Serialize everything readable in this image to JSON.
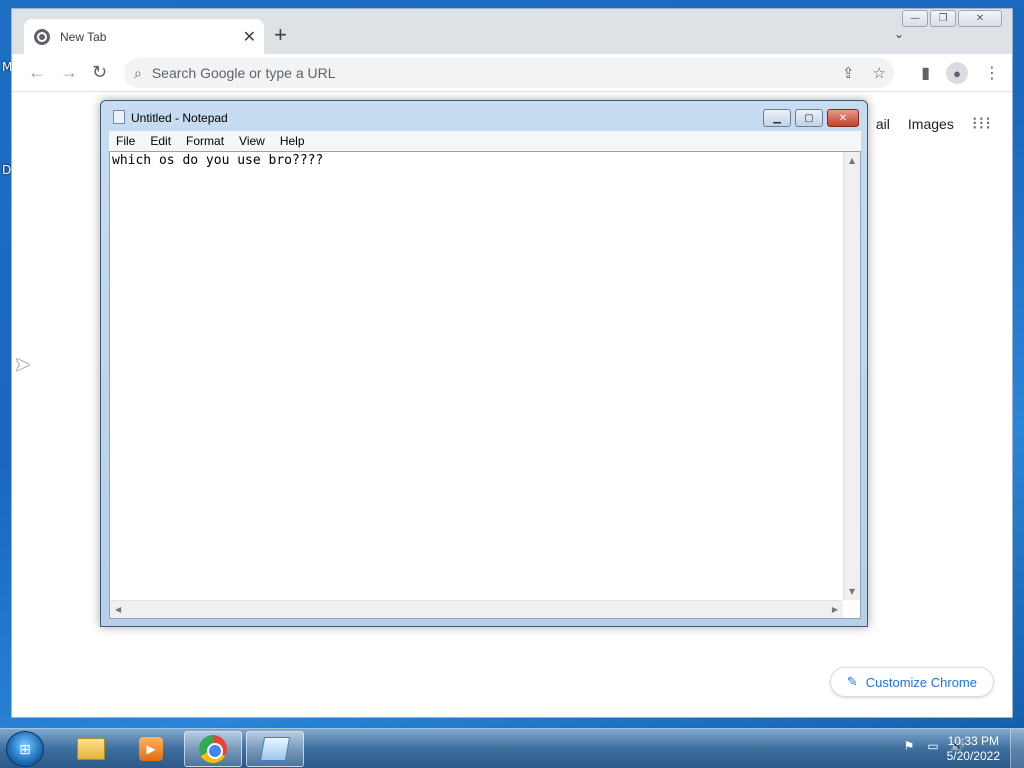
{
  "desktop": {
    "edge_labels": [
      "M",
      "D"
    ]
  },
  "chrome": {
    "tab": {
      "title": "New Tab",
      "close_icon": "✕"
    },
    "new_tab_icon": "+",
    "tab_search_icon": "⌄",
    "window_controls": {
      "minimize": "—",
      "maximize": "❐",
      "close": "✕"
    },
    "toolbar": {
      "back_icon": "←",
      "forward_icon": "→",
      "reload_icon": "↻",
      "omnibox_placeholder": "Search Google or type a URL",
      "search_icon": "🔍",
      "share_icon": "⇪",
      "star_icon": "☆",
      "sidepanel_icon": "▮",
      "profile_icon": "👤",
      "menu_icon": "⋮"
    },
    "ntp": {
      "gmail_label": "ail",
      "images_label": "Images",
      "apps_icon": "⋮⋮⋮",
      "customize_label": "Customize Chrome",
      "customize_icon": "✎"
    }
  },
  "notepad": {
    "title": "Untitled - Notepad",
    "controls": {
      "minimize": "▁",
      "maximize": "▢",
      "close": "✕"
    },
    "menu": [
      "File",
      "Edit",
      "Format",
      "View",
      "Help"
    ],
    "content": "which os do you use bro????"
  },
  "taskbar": {
    "start_icon": "⊞",
    "apps": [
      {
        "name": "explorer",
        "active": false
      },
      {
        "name": "media-player",
        "active": false
      },
      {
        "name": "chrome",
        "active": true
      },
      {
        "name": "notepad",
        "active": true
      }
    ],
    "tray_icons": [
      "⚑",
      "▭",
      "🔊"
    ],
    "time": "10:33 PM",
    "date": "5/20/2022"
  },
  "colors": {
    "accent": "#1a73e8",
    "desktop_blue": "#1e6fc4",
    "chrome_frame": "#dee1e6"
  }
}
